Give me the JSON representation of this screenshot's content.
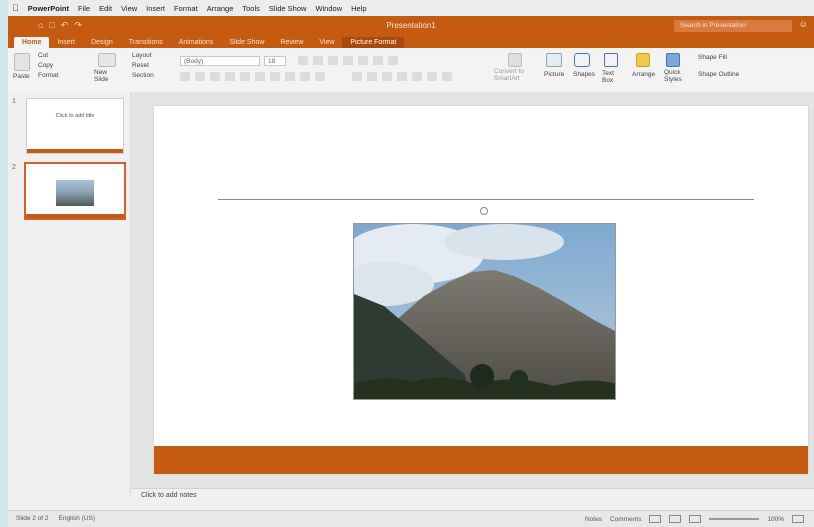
{
  "menubar": {
    "app_name": "PowerPoint",
    "items": [
      "File",
      "Edit",
      "View",
      "Insert",
      "Format",
      "Arrange",
      "Tools",
      "Slide Show",
      "Window",
      "Help"
    ]
  },
  "titlebar": {
    "title": "Presentation1",
    "search_placeholder": "Search in Presentation"
  },
  "ribbon_tabs": [
    "Home",
    "Insert",
    "Design",
    "Transitions",
    "Animations",
    "Slide Show",
    "Review",
    "View",
    "Picture Format"
  ],
  "ribbon": {
    "paste": "Paste",
    "cut": "Cut",
    "copy": "Copy",
    "format": "Format",
    "new_slide": "New Slide",
    "layout": "Layout",
    "reset": "Reset",
    "section": "Section",
    "font_name": "(Body)",
    "font_size": "18",
    "convert_smartart": "Convert to SmartArt",
    "picture": "Picture",
    "shapes": "Shapes",
    "text_box": "Text Box",
    "arrange": "Arrange",
    "quick_styles": "Quick Styles",
    "shape_fill": "Shape Fill",
    "shape_outline": "Shape Outline"
  },
  "thumbnails": [
    {
      "number": "1",
      "title": "Click to add title"
    },
    {
      "number": "2",
      "title": ""
    }
  ],
  "notes": {
    "placeholder": "Click to add notes"
  },
  "status": {
    "slide": "Slide 2 of 2",
    "language": "English (US)",
    "notes_btn": "Notes",
    "comments_btn": "Comments",
    "zoom": "100%"
  },
  "colors": {
    "accent": "#c55a11",
    "titlebar": "#c55a11"
  }
}
